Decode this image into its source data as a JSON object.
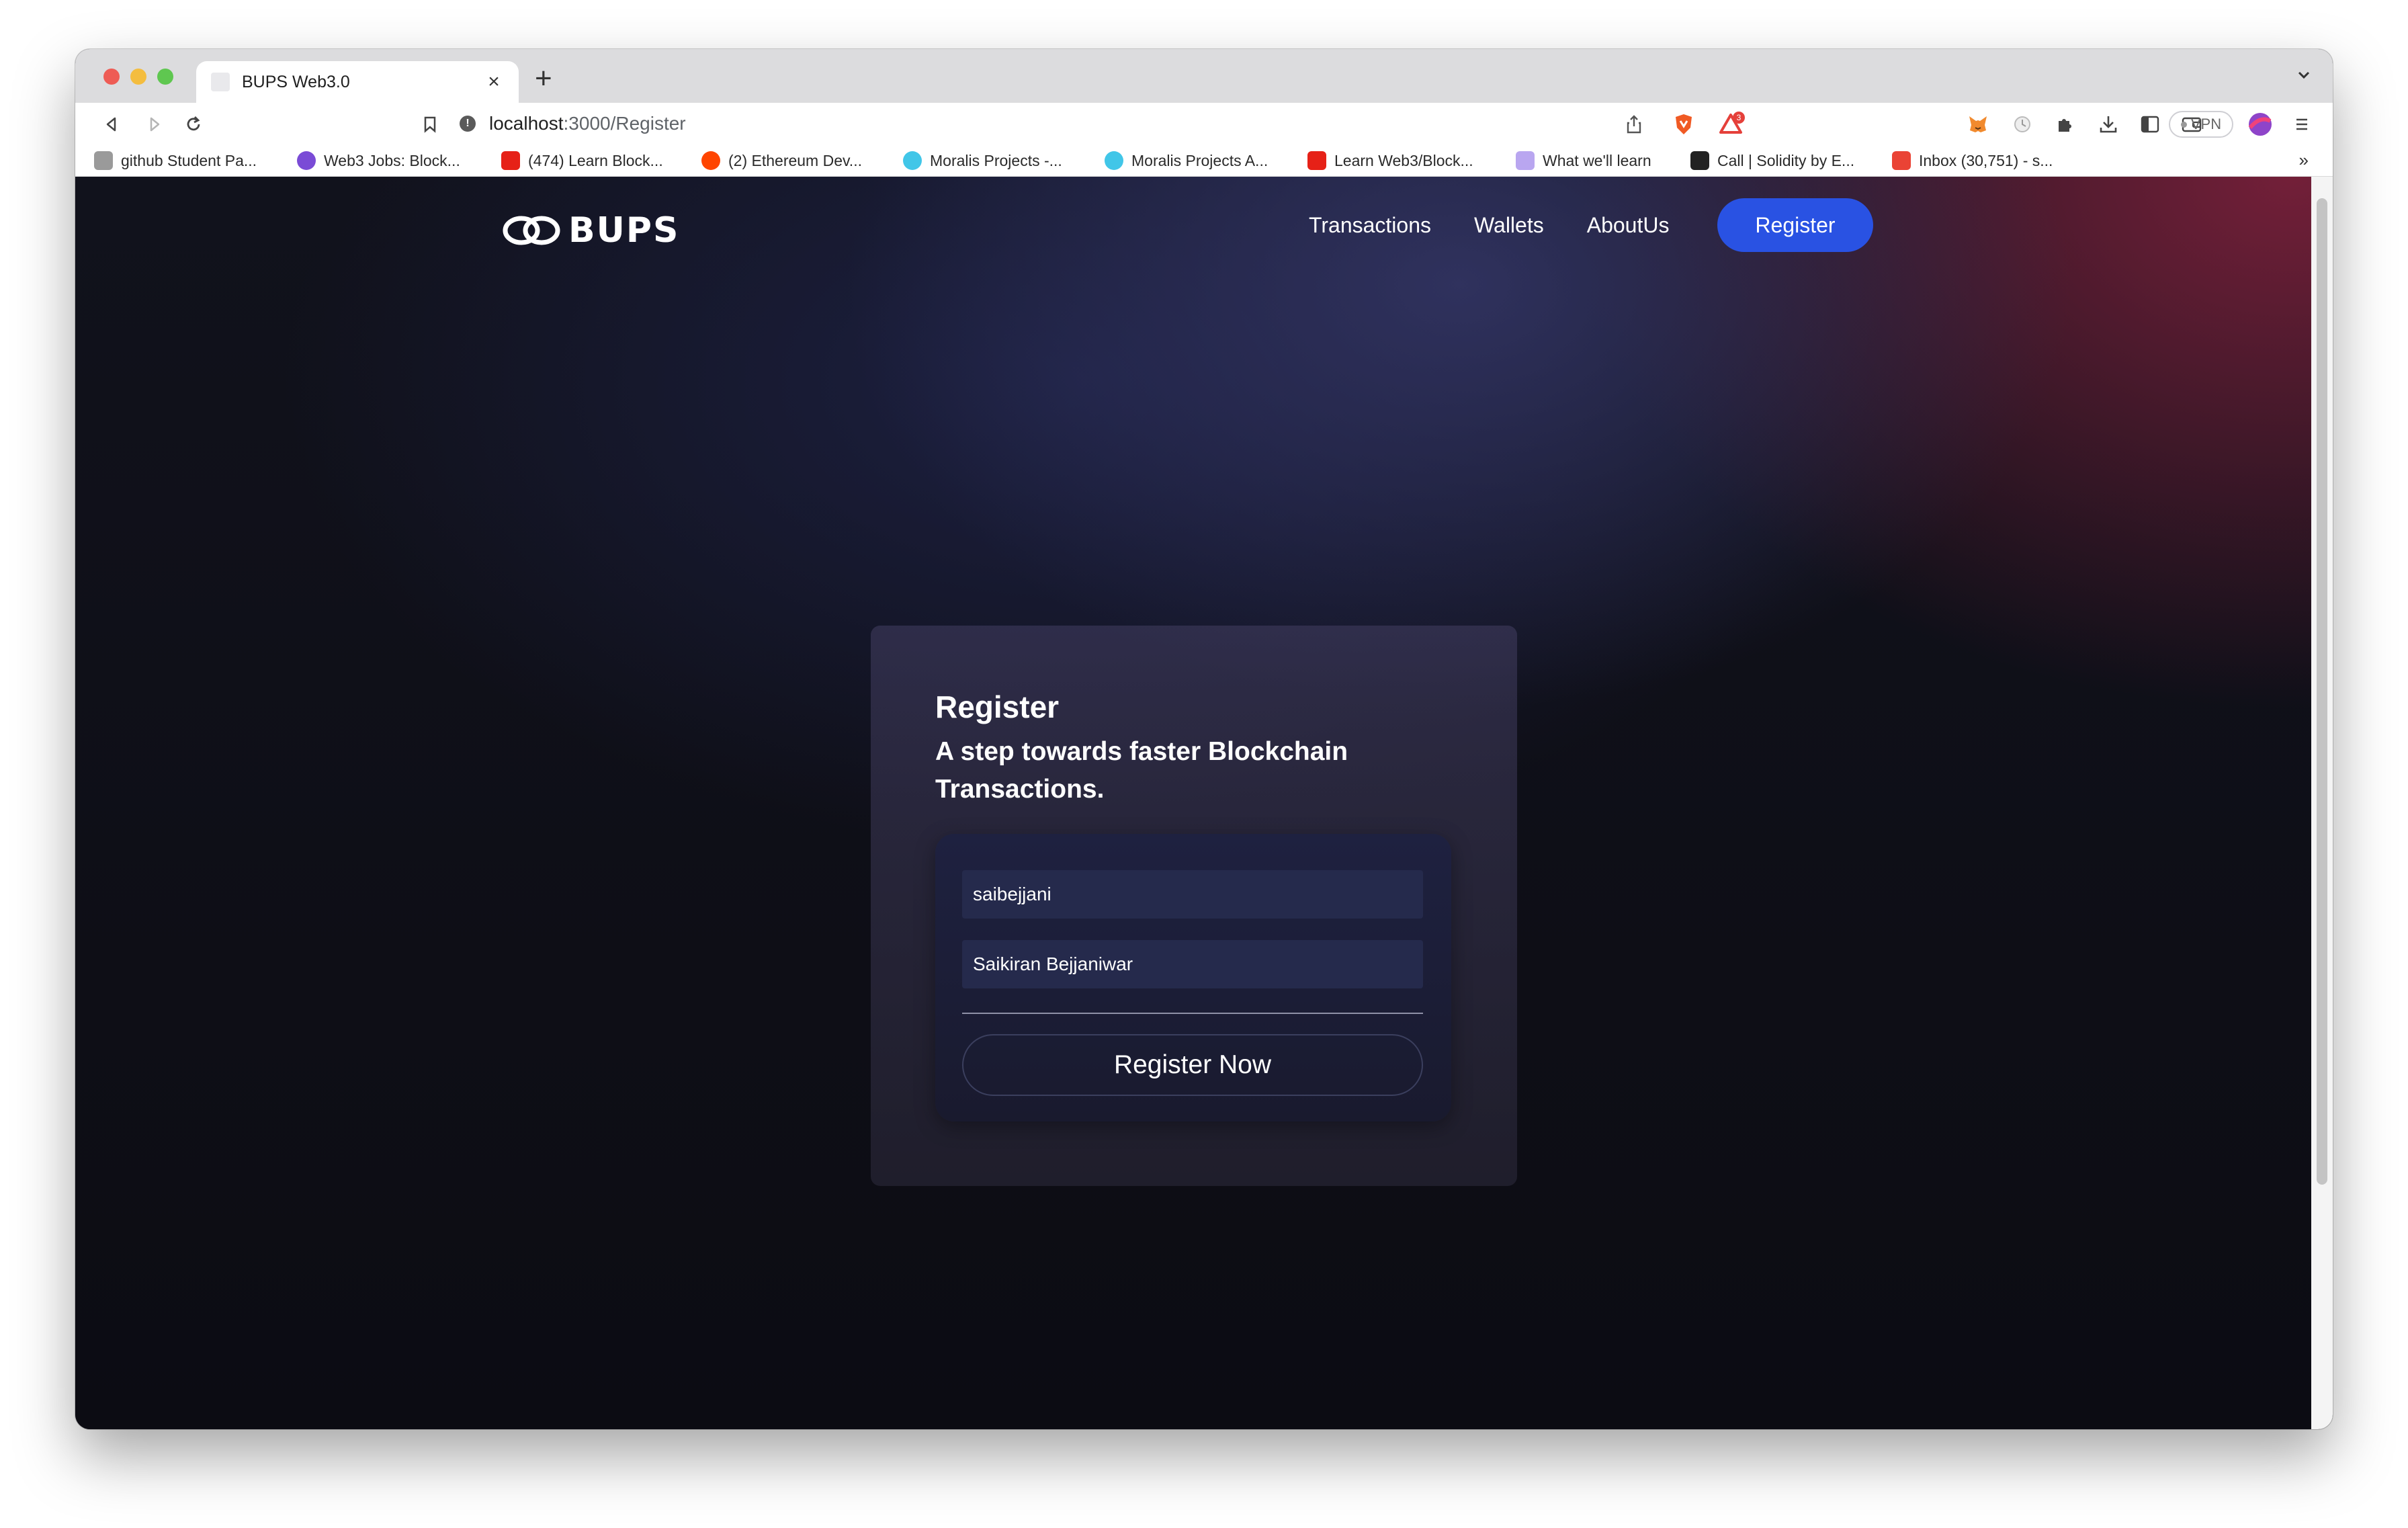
{
  "browser": {
    "tab_title": "BUPS Web3.0",
    "url_host": "localhost",
    "url_path": ":3000/Register",
    "vpn_label": "VPN",
    "notification_count": "3",
    "bookmarks": [
      {
        "label": "github Student Pa...",
        "icon": "folder-icon",
        "color": "#8a8a8a"
      },
      {
        "label": "Web3 Jobs: Block...",
        "icon": "web3-jobs-icon",
        "color": "#7a4bd6"
      },
      {
        "label": "(474) Learn Block...",
        "icon": "youtube-icon",
        "color": "#e62117"
      },
      {
        "label": "(2) Ethereum Dev...",
        "icon": "reddit-icon",
        "color": "#ff4500"
      },
      {
        "label": "Moralis Projects -...",
        "icon": "moralis-icon",
        "color": "#41c6e8"
      },
      {
        "label": "Moralis Projects A...",
        "icon": "moralis-icon",
        "color": "#41c6e8"
      },
      {
        "label": "Learn Web3/Block...",
        "icon": "youtube-icon",
        "color": "#e62117"
      },
      {
        "label": "What we'll learn",
        "icon": "course-icon",
        "color": "#b9a6f0"
      },
      {
        "label": "Call | Solidity by E...",
        "icon": "solidity-icon",
        "color": "#222222"
      },
      {
        "label": "Inbox (30,751) - s...",
        "icon": "gmail-icon",
        "color": "#ea4335"
      }
    ]
  },
  "page": {
    "brand": "BUPS",
    "nav": {
      "transactions": "Transactions",
      "wallets": "Wallets",
      "about": "AboutUs",
      "register": "Register"
    },
    "card": {
      "title": "Register",
      "subtitle": "A step towards faster Blockchain Transactions.",
      "username_value": "saibejjani",
      "fullname_value": "Saikiran Bejjaniwar",
      "submit_label": "Register Now"
    },
    "colors": {
      "accent": "#2952e3",
      "background": "#0d0d14"
    }
  }
}
